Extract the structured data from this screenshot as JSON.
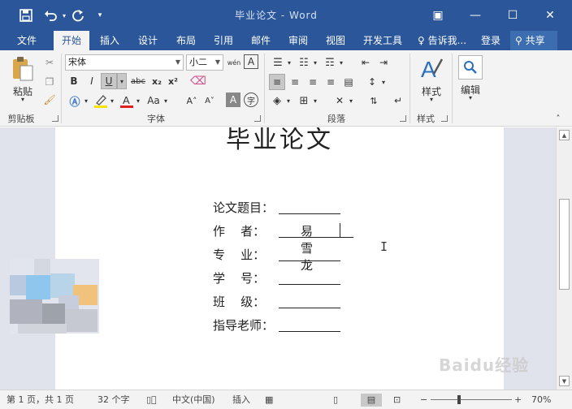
{
  "window": {
    "title": "毕业论文 - Word",
    "minimize_glyph": "—",
    "maximize_glyph": "☐",
    "close_glyph": "✕",
    "ribbon_display_glyph": "▣"
  },
  "quick_access": {
    "save_icon": "save-icon",
    "undo_icon": "undo-icon",
    "redo_icon": "redo-icon",
    "customize_glyph": "▾"
  },
  "tabs": [
    {
      "label": "文件"
    },
    {
      "label": "开始",
      "active": true
    },
    {
      "label": "插入"
    },
    {
      "label": "设计"
    },
    {
      "label": "布局"
    },
    {
      "label": "引用"
    },
    {
      "label": "邮件"
    },
    {
      "label": "审阅"
    },
    {
      "label": "视图"
    },
    {
      "label": "开发工具"
    }
  ],
  "tell_me": "告诉我...",
  "login": "登录",
  "share": "共享",
  "ribbon": {
    "clipboard": {
      "label": "剪贴板",
      "paste": "粘贴",
      "paste_dd": "▾"
    },
    "font": {
      "label": "字体",
      "font_name": "宋体",
      "font_size": "小二",
      "bold": "B",
      "italic": "I",
      "underline": "U",
      "strike": "abc",
      "subscript": "x₂",
      "superscript": "x²",
      "grow": "A˄",
      "shrink": "A˅",
      "font_color": "A",
      "change_case": "Aa",
      "phonetic": "wén",
      "char_border": "A",
      "char_shading": "A",
      "enclose": "字"
    },
    "paragraph": {
      "label": "段落"
    },
    "styles": {
      "label": "样式",
      "button": "样式"
    },
    "editing": {
      "label": "",
      "button": "编辑"
    }
  },
  "document": {
    "heading": "毕业论文",
    "fields": [
      {
        "label": "论文题目：",
        "value": ""
      },
      {
        "label": "作    者：",
        "value": "易雪龙"
      },
      {
        "label": "专    业：",
        "value": ""
      },
      {
        "label": "学    号：",
        "value": ""
      },
      {
        "label": "班    级：",
        "value": ""
      },
      {
        "label": "指导老师：",
        "value": ""
      }
    ]
  },
  "status": {
    "page": "第 1 页，共 1 页",
    "words": "32 个字",
    "language": "中文(中国)",
    "mode": "插入",
    "zoom": "70%",
    "zoom_minus": "−",
    "zoom_plus": "+"
  },
  "watermark": "Baidu经验",
  "colors": {
    "accent": "#2b579a",
    "ribbon_bg": "#f3f3f3",
    "doc_bg": "#e1e3ec"
  }
}
